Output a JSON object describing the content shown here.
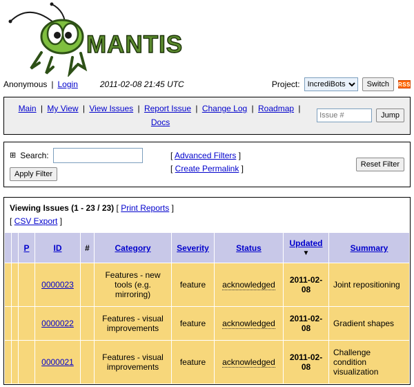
{
  "user": {
    "name": "Anonymous",
    "login_label": "Login"
  },
  "timestamp": "2011-02-08 21:45 UTC",
  "project": {
    "label": "Project:",
    "selected": "IncrediBots",
    "switch_label": "Switch"
  },
  "rss_label": "RSS",
  "nav": {
    "items": [
      "Main",
      "My View",
      "View Issues",
      "Report Issue",
      "Change Log",
      "Roadmap",
      "Docs"
    ],
    "issue_placeholder": "Issue #",
    "jump_label": "Jump"
  },
  "search": {
    "label": "Search:",
    "apply_label": "Apply Filter",
    "advanced_label": "Advanced Filters",
    "permalink_label": "Create Permalink",
    "reset_label": "Reset Filter"
  },
  "issues": {
    "title": "Viewing Issues (1 - 23 / 23)",
    "print_label": "Print Reports",
    "csv_label": "CSV Export",
    "columns": {
      "p": "P",
      "id": "ID",
      "hash": "#",
      "category": "Category",
      "severity": "Severity",
      "status": "Status",
      "updated": "Updated",
      "summary": "Summary"
    },
    "rows": [
      {
        "id": "0000023",
        "category": "Features - new tools (e.g. mirroring)",
        "severity": "feature",
        "status": "acknowledged",
        "updated": "2011-02-08",
        "summary": "Joint repositioning"
      },
      {
        "id": "0000022",
        "category": "Features - visual improvements",
        "severity": "feature",
        "status": "acknowledged",
        "updated": "2011-02-08",
        "summary": "Gradient shapes"
      },
      {
        "id": "0000021",
        "category": "Features - visual improvements",
        "severity": "feature",
        "status": "acknowledged",
        "updated": "2011-02-08",
        "summary": "Challenge condition visualization"
      }
    ]
  }
}
